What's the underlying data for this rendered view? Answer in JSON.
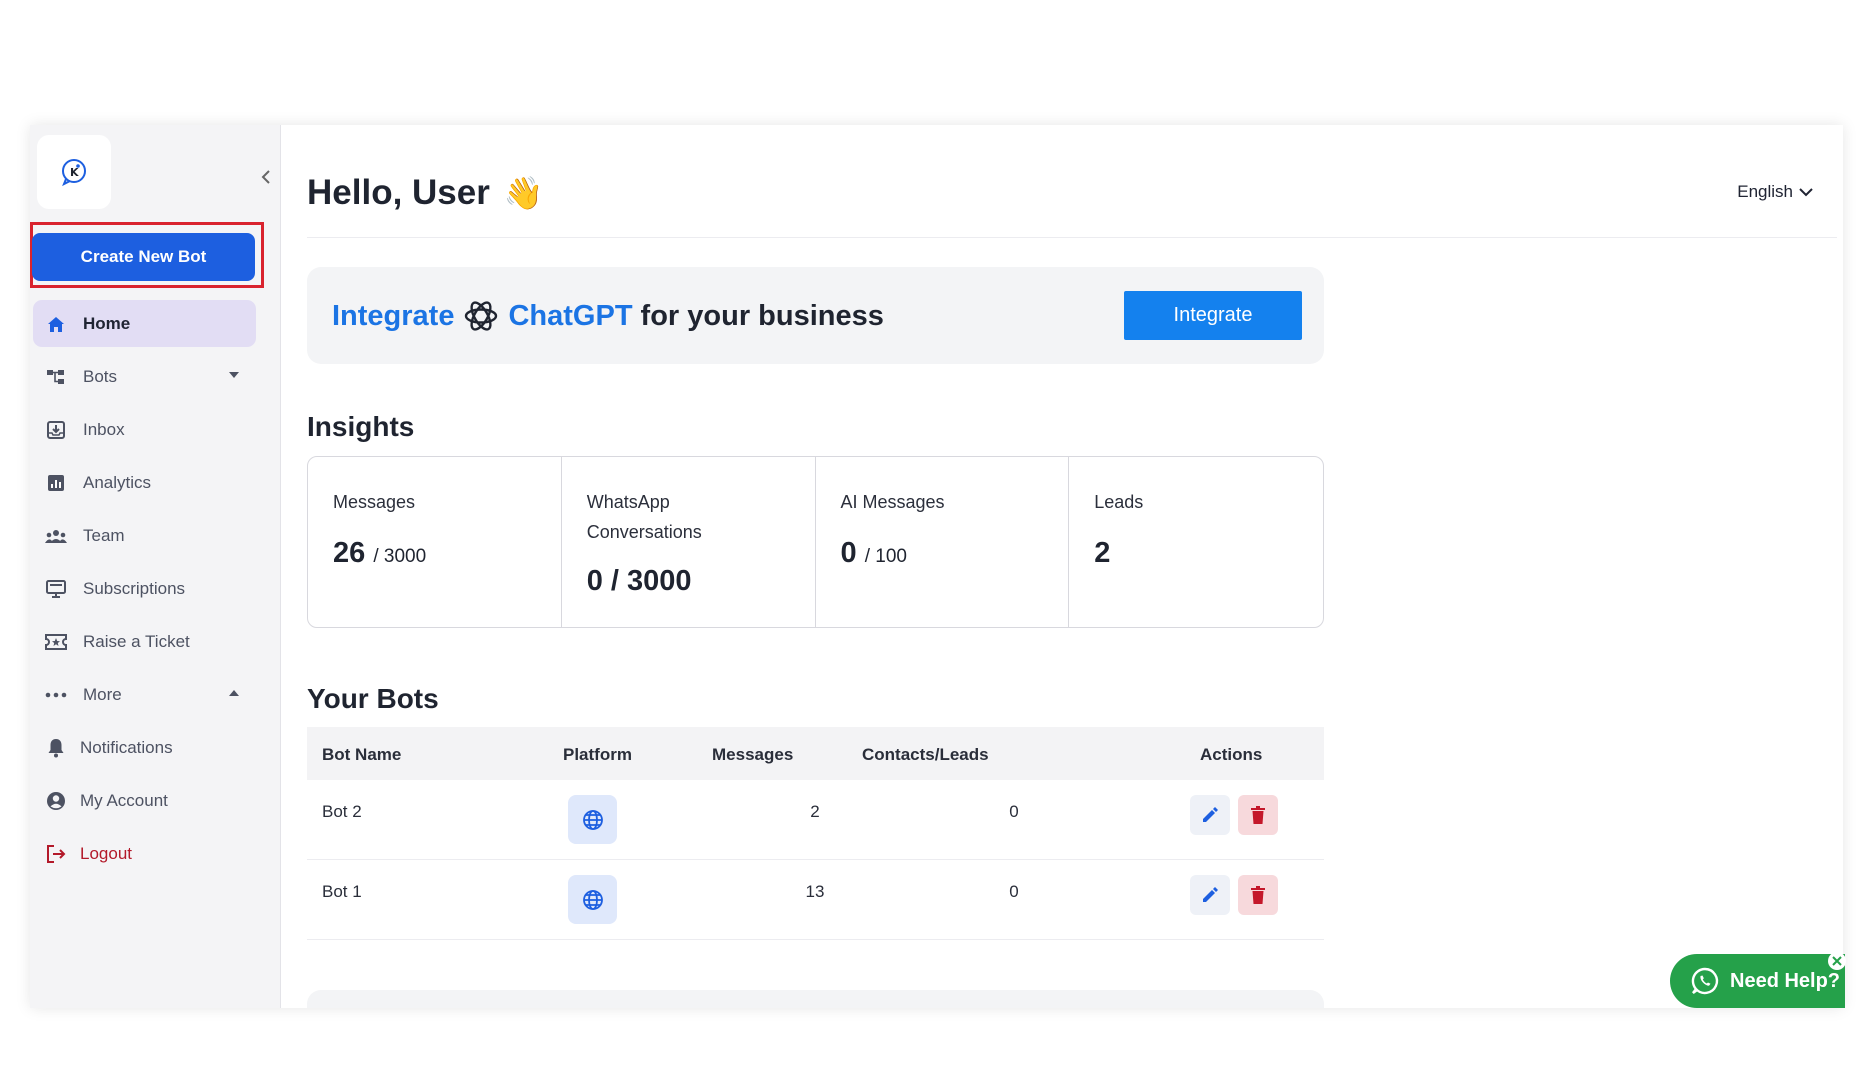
{
  "sidebar": {
    "create_button": "Create New Bot",
    "items": [
      {
        "label": "Home",
        "icon": "home-icon"
      },
      {
        "label": "Bots",
        "icon": "bots-icon"
      },
      {
        "label": "Inbox",
        "icon": "inbox-icon"
      },
      {
        "label": "Analytics",
        "icon": "analytics-icon"
      },
      {
        "label": "Team",
        "icon": "team-icon"
      },
      {
        "label": "Subscriptions",
        "icon": "subscriptions-icon"
      },
      {
        "label": "Raise a Ticket",
        "icon": "ticket-icon"
      },
      {
        "label": "More",
        "icon": "more-icon"
      },
      {
        "label": "Notifications",
        "icon": "bell-icon"
      },
      {
        "label": "My Account",
        "icon": "account-icon"
      },
      {
        "label": "Logout",
        "icon": "logout-icon"
      }
    ]
  },
  "header": {
    "greeting": "Hello, User",
    "wave": "👋",
    "language": "English"
  },
  "banner": {
    "integrate_word": "Integrate",
    "chatgpt_word": "ChatGPT",
    "rest": "for your business",
    "button": "Integrate"
  },
  "insights": {
    "title": "Insights",
    "cards": [
      {
        "label": "Messages",
        "value": "26",
        "limit": "/ 3000"
      },
      {
        "label": "WhatsApp Conversations",
        "value": "0 / 3000",
        "limit": ""
      },
      {
        "label": "AI Messages",
        "value": "0",
        "limit": "/ 100"
      },
      {
        "label": "Leads",
        "value": "2",
        "limit": ""
      }
    ]
  },
  "bots": {
    "title": "Your Bots",
    "columns": [
      "Bot Name",
      "Platform",
      "Messages",
      "Contacts/Leads",
      "Actions"
    ],
    "rows": [
      {
        "name": "Bot 2",
        "messages": "2",
        "contacts": "0"
      },
      {
        "name": "Bot 1",
        "messages": "13",
        "contacts": "0"
      }
    ]
  },
  "help": {
    "label": "Need Help?"
  },
  "colors": {
    "primary": "#1d5fe0",
    "accent": "#1b74e4",
    "highlight": "#d9232e",
    "whatsapp": "#25a14a"
  }
}
